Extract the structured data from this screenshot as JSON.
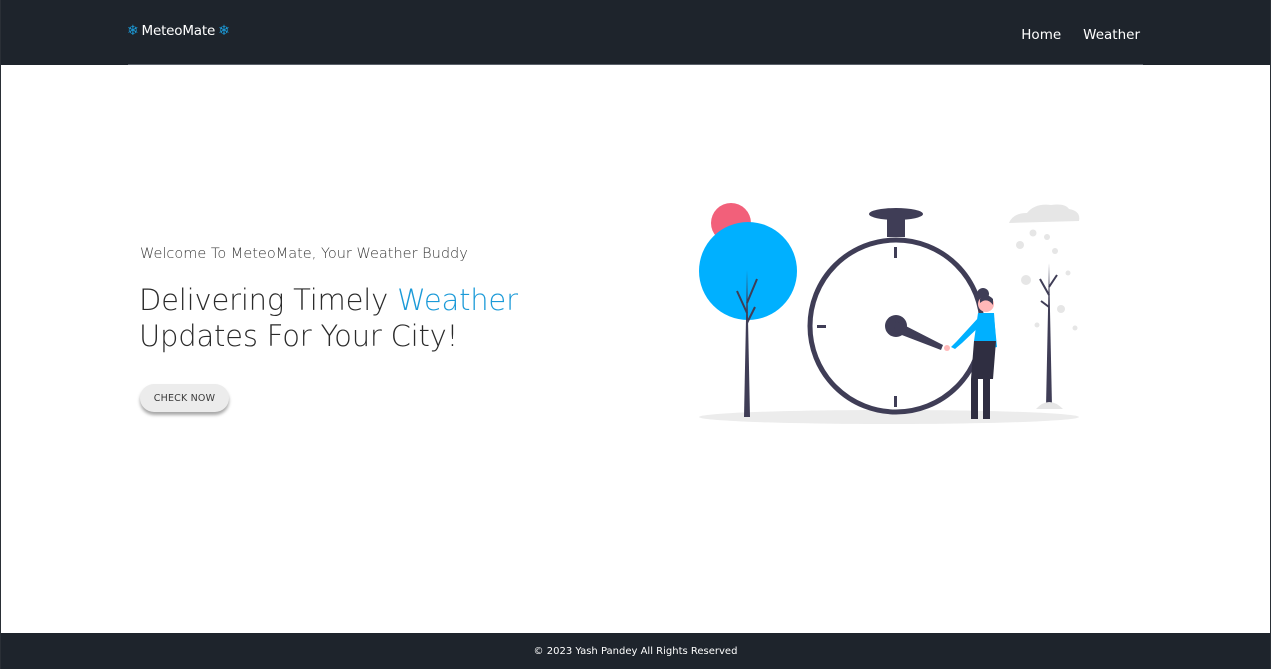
{
  "header": {
    "brand": "MeteoMate",
    "brand_icon": "snowflake-icon",
    "nav": [
      "Home",
      "Weather"
    ]
  },
  "hero": {
    "subtitle": "Welcome To MeteoMate, Your Weather Buddy",
    "title_part1": "Delivering Timely ",
    "title_accent": "Weather",
    "title_part2": "Updates For Your City!",
    "cta_label": "CHECK NOW",
    "illustration": "stopwatch-woman-trees-illustration"
  },
  "footer": {
    "copyright": "© 2023 Yash Pandey All Rights Reserved"
  },
  "colors": {
    "navbar": "#1e242c",
    "accent": "#1b9ad8",
    "illustration_blue": "#00b0ff",
    "illustration_pink": "#f2607a",
    "illustration_dark": "#3f3d56"
  }
}
